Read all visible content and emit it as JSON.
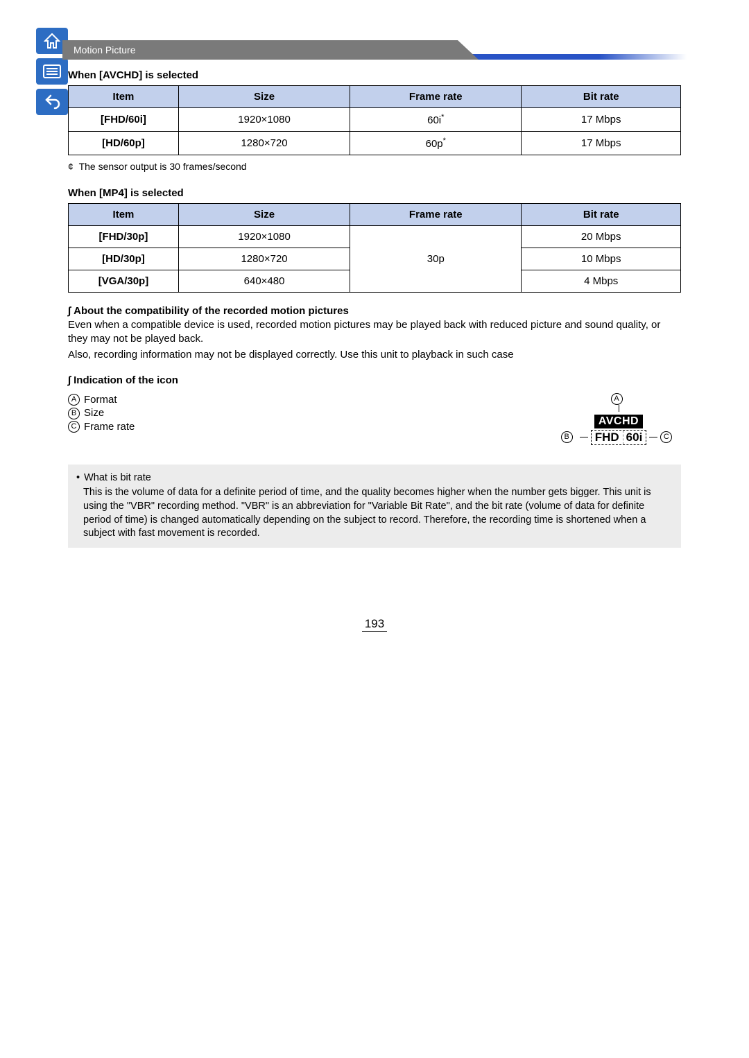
{
  "header": {
    "category": "Motion Picture"
  },
  "nav": {
    "home": "home-icon",
    "menu": "menu-icon",
    "back": "back-icon"
  },
  "avchd": {
    "title": "When [AVCHD] is selected",
    "headers": {
      "item": "Item",
      "size": "Size",
      "frame": "Frame rate",
      "bit": "Bit rate"
    },
    "rows": [
      {
        "item": "[FHD/60i]",
        "size": "1920×1080",
        "frame": "60i",
        "frame_sup": "*",
        "bit": "17 Mbps"
      },
      {
        "item": "[HD/60p]",
        "size": "1280×720",
        "frame": "60p",
        "frame_sup": "*",
        "bit": "17 Mbps"
      }
    ],
    "footnote_sym": "¢",
    "footnote": "The sensor output is 30 frames/second"
  },
  "mp4": {
    "title": "When [MP4] is selected",
    "headers": {
      "item": "Item",
      "size": "Size",
      "frame": "Frame rate",
      "bit": "Bit rate"
    },
    "rows": [
      {
        "item": "[FHD/30p]",
        "size": "1920×1080",
        "bit": "20 Mbps"
      },
      {
        "item": "[HD/30p]",
        "size": "1280×720",
        "bit": "10 Mbps"
      },
      {
        "item": "[VGA/30p]",
        "size": "640×480",
        "bit": "4 Mbps"
      }
    ],
    "frame_merged": "30p"
  },
  "compat": {
    "title": "About the compatibility of the recorded motion pictures",
    "p1": "Even when a compatible device is used, recorded motion pictures may be played back with reduced picture and sound quality, or they may not be played back.",
    "p2": "Also, recording information may not be displayed correctly. Use this unit to playback in such case"
  },
  "indic": {
    "title": "Indication of the icon",
    "items": [
      {
        "label": "A",
        "text": "Format"
      },
      {
        "label": "B",
        "text": "Size"
      },
      {
        "label": "C",
        "text": "Frame rate"
      }
    ],
    "fig": {
      "a": "A",
      "b": "B",
      "c": "C",
      "avchd": "AVCHD",
      "size": "FHD",
      "rate": "60i"
    }
  },
  "note": {
    "title": "What is bit rate",
    "body": "This is the volume of data for a definite period of time, and the quality becomes higher when the number gets bigger. This unit is using the \"VBR\" recording method. \"VBR\" is an abbreviation for \"Variable Bit Rate\", and the bit rate (volume of data for definite period of time) is changed automatically depending on the subject to record. Therefore, the recording time is shortened when a subject with fast movement is recorded."
  },
  "page_number": "193"
}
